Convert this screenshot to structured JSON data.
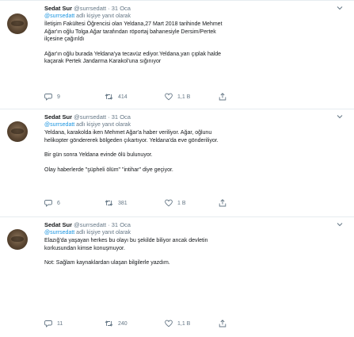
{
  "tweets": [
    {
      "name": "Sedat Sur",
      "handle": "@surrsedatt",
      "date": "31 Oca",
      "reply_prefix": "",
      "reply_mention": "@surrsedatt",
      "reply_suffix": " adlı kişiye yanıt olarak",
      "paragraphs": [
        "İletişim Fakültesi Öğrencisi olan Yeldana,27 Mart 2018 tarihinde Mehmet",
        "Ağar'ın oğlu Tolga Ağar tarafından röportaj bahanesiyle Dersim/Pertek",
        "ilçesine çağırıldı",
        "",
        "Ağar'ın oğlu burada Yeldana'ya tecavüz ediyor.Yeldana,yarı çıplak halde",
        "kaçarak Pertek Jandarma Karakol'una sığınıyor"
      ],
      "replies": "9",
      "retweets": "414",
      "likes": "1,1 B"
    },
    {
      "name": "Sedat Sur",
      "handle": "@surrsedatt",
      "date": "31 Oca",
      "reply_mention": "@surrsedatt",
      "reply_suffix": " adlı kişiye yanıt olarak",
      "paragraphs": [
        "Yeldana, karakolda iken Mehmet Ağar'a haber veriliyor. Ağar, oğlunu",
        "helikopter göndererek bölgeden çıkartıyor. Yeldana'da eve gönderiliyor.",
        "",
        "Bir gün sonra Yeldana evinde ölü bulunuyor.",
        "",
        "Olay haberlerde \"şüpheli ölüm\" \"intihar\" diye geçiyor."
      ],
      "replies": "6",
      "retweets": "381",
      "likes": "1 B"
    },
    {
      "name": "Sedat Sur",
      "handle": "@surrsedatt",
      "date": "31 Oca",
      "reply_mention": "@surrsedatt",
      "reply_suffix": " adlı kişiye yanıt olarak",
      "paragraphs": [
        "Elazığ'da yaşayan herkes bu olayı bu şekilde biliyor ancak devletin",
        "korkusundan kimse konuşmuyor.",
        "",
        "Not: Sağlam kaynaklardan ulaşan bilgilerle yazdım."
      ],
      "replies": "11",
      "retweets": "240",
      "likes": "1,1 B"
    }
  ],
  "icons": {
    "reply": "reply-icon",
    "retweet": "retweet-icon",
    "like": "heart-icon",
    "share": "share-icon",
    "caret": "chevron-down-icon"
  },
  "colors": {
    "text": "#14171a",
    "muted": "#657786",
    "link": "#1b95e0",
    "divider": "#e6ecf0"
  }
}
